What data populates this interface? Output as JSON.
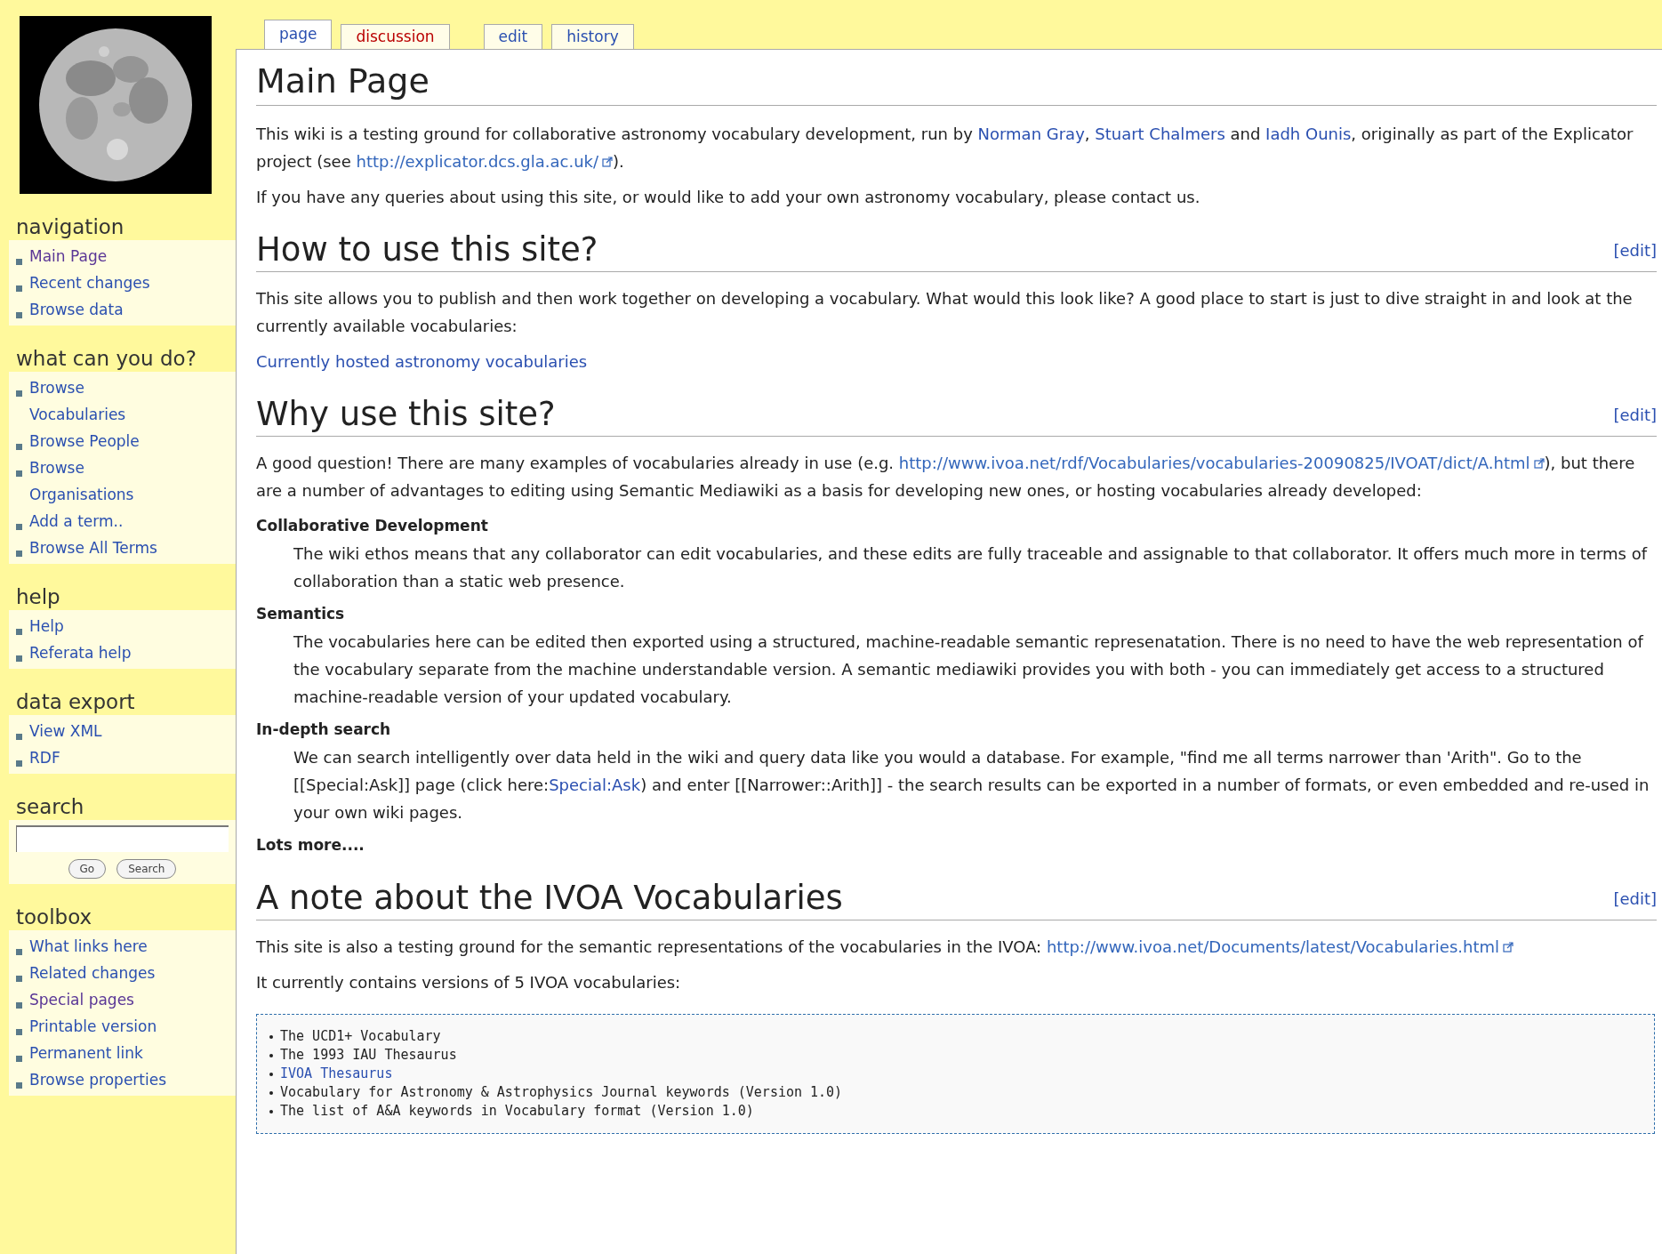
{
  "tabs": [
    {
      "label": "page",
      "selected": true,
      "missing": false
    },
    {
      "label": "discussion",
      "selected": false,
      "missing": true
    },
    {
      "label": "edit",
      "selected": false,
      "missing": false
    },
    {
      "label": "history",
      "selected": false,
      "missing": false
    }
  ],
  "sidebar": [
    {
      "kind": "links",
      "title": "navigation",
      "items": [
        {
          "label": "Main Page",
          "visited": true
        },
        {
          "label": "Recent changes",
          "visited": false
        },
        {
          "label": "Browse data",
          "visited": false
        }
      ]
    },
    {
      "kind": "links",
      "title": "what can you do?",
      "items": [
        {
          "label": "Browse Vocabularies",
          "visited": false
        },
        {
          "label": "Browse People",
          "visited": false
        },
        {
          "label": "Browse Organisations",
          "visited": false
        },
        {
          "label": "Add a term..",
          "visited": false
        },
        {
          "label": "Browse All Terms",
          "visited": false
        }
      ]
    },
    {
      "kind": "links",
      "title": "help",
      "items": [
        {
          "label": "Help",
          "visited": false
        },
        {
          "label": "Referata help",
          "visited": false
        }
      ]
    },
    {
      "kind": "links",
      "title": "data export",
      "items": [
        {
          "label": "View XML",
          "visited": false
        },
        {
          "label": "RDF",
          "visited": false
        }
      ]
    },
    {
      "kind": "search",
      "title": "search",
      "buttons": [
        "Go",
        "Search"
      ]
    },
    {
      "kind": "links",
      "title": "toolbox",
      "items": [
        {
          "label": "What links here",
          "visited": false
        },
        {
          "label": "Related changes",
          "visited": false
        },
        {
          "label": "Special pages",
          "visited": true
        },
        {
          "label": "Printable version",
          "visited": false
        },
        {
          "label": "Permanent link",
          "visited": false
        },
        {
          "label": "Browse properties",
          "visited": false
        }
      ]
    }
  ],
  "content": {
    "title": "Main Page",
    "blocks": [
      {
        "kind": "paragraph",
        "segments": [
          {
            "kind": "text",
            "text": "This wiki is a testing ground for collaborative astronomy vocabulary development, run by "
          },
          {
            "kind": "link",
            "text": "Norman Gray"
          },
          {
            "kind": "text",
            "text": ", "
          },
          {
            "kind": "link",
            "text": "Stuart Chalmers"
          },
          {
            "kind": "text",
            "text": " and "
          },
          {
            "kind": "link",
            "text": "Iadh Ounis"
          },
          {
            "kind": "text",
            "text": ", originally as part of the Explicator project (see "
          },
          {
            "kind": "external",
            "text": "http://explicator.dcs.gla.ac.uk/"
          },
          {
            "kind": "text",
            "text": ")."
          }
        ]
      },
      {
        "kind": "paragraph",
        "segments": [
          {
            "kind": "text",
            "text": "If you have any queries about using this site, or would like to add your own astronomy vocabulary, please contact us."
          }
        ]
      },
      {
        "kind": "heading",
        "text": "How to use this site?",
        "edit": "[edit]"
      },
      {
        "kind": "paragraph",
        "segments": [
          {
            "kind": "text",
            "text": "This site allows you to publish and then work together on developing a vocabulary. What would this look like? A good place to start is just to dive straight in and look at the currently available vocabularies:"
          }
        ]
      },
      {
        "kind": "paragraph",
        "segments": [
          {
            "kind": "link",
            "text": "Currently hosted astronomy vocabularies"
          }
        ]
      },
      {
        "kind": "heading",
        "text": "Why use this site?",
        "edit": "[edit]"
      },
      {
        "kind": "paragraph",
        "segments": [
          {
            "kind": "text",
            "text": "A good question! There are many examples of vocabularies already in use (e.g. "
          },
          {
            "kind": "external",
            "text": "http://www.ivoa.net/rdf/Vocabularies/vocabularies-20090825/IVOAT/dict/A.html"
          },
          {
            "kind": "text",
            "text": "), but there are a number of advantages to editing using Semantic Mediawiki as a basis for developing new ones, or hosting vocabularies already developed:"
          }
        ]
      },
      {
        "kind": "definition",
        "term": "Collaborative Development",
        "segments": [
          {
            "kind": "text",
            "text": "The wiki ethos means that any collaborator can edit vocabularies, and these edits are fully traceable and assignable to that collaborator. It offers much more in terms of collaboration than a static web presence."
          }
        ]
      },
      {
        "kind": "definition",
        "term": "Semantics",
        "segments": [
          {
            "kind": "text",
            "text": "The vocabularies here can be edited then exported using a structured, machine-readable semantic represenatation. There is no need to have the web representation of the vocabulary separate from the machine understandable version. A semantic mediawiki provides you with both - you can immediately get access to a structured machine-readable version of your updated vocabulary."
          }
        ]
      },
      {
        "kind": "definition",
        "term": "In-depth search",
        "segments": [
          {
            "kind": "text",
            "text": "We can search intelligently over data held in the wiki and query data like you would a database. For example, \"find me all terms narrower than 'Arith\". Go to the [[Special:Ask]] page (click here:"
          },
          {
            "kind": "link",
            "text": "Special:Ask"
          },
          {
            "kind": "text",
            "text": ") and enter [[Narrower::Arith]] - the search results can be exported in a number of formats, or even embedded and re-used in your own wiki pages."
          }
        ]
      },
      {
        "kind": "note",
        "text": "Lots more...."
      },
      {
        "kind": "heading",
        "text": "A note about the IVOA Vocabularies",
        "edit": "[edit]"
      },
      {
        "kind": "paragraph",
        "segments": [
          {
            "kind": "text",
            "text": "This site is also a testing ground for the semantic representations of the vocabularies in the IVOA: "
          },
          {
            "kind": "external",
            "text": "http://www.ivoa.net/Documents/latest/Vocabularies.html"
          }
        ]
      },
      {
        "kind": "paragraph",
        "segments": [
          {
            "kind": "text",
            "text": "It currently contains versions of 5 IVOA vocabularies:"
          }
        ]
      },
      {
        "kind": "pre",
        "lines": [
          {
            "text": "The UCD1+ Vocabulary",
            "link": false
          },
          {
            "text": "The 1993 IAU Thesaurus",
            "link": false
          },
          {
            "text": "IVOA Thesaurus",
            "link": true
          },
          {
            "text": "Vocabulary for Astronomy & Astrophysics Journal keywords (Version 1.0)",
            "link": false
          },
          {
            "text": "The list of A&A keywords in Vocabulary format (Version 1.0)",
            "link": false
          }
        ]
      }
    ]
  }
}
